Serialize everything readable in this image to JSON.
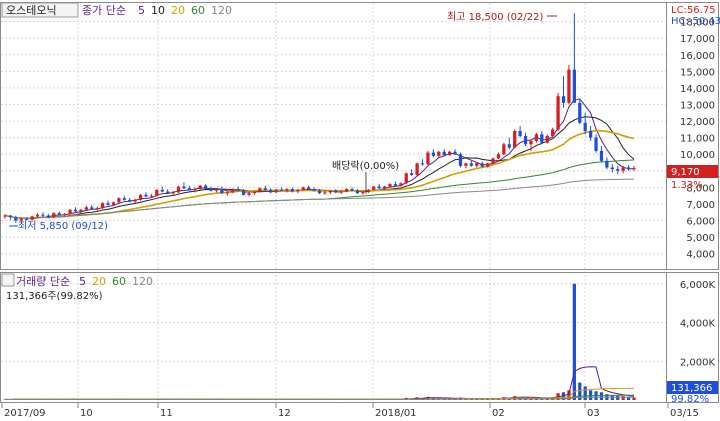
{
  "price_panel": {
    "stock_name": "오스테오닉",
    "ma_label": "종가 단순",
    "ma_periods": [
      "5",
      "10",
      "20",
      "60",
      "120"
    ],
    "ma_colors": [
      "#5a1e8c",
      "#222222",
      "#d4a000",
      "#2e8b2e",
      "#888888"
    ],
    "lc_text": "LC:56.75",
    "hc_text": "HC:-50.43",
    "high_annotation": "최고 18,500 (02/22)",
    "low_annotation": "최저 5,850 (09/12)",
    "dividend_annotation": "배당락(0.00%)",
    "current_price": "9,170",
    "current_change": "1.33%"
  },
  "volume_panel": {
    "label": "거래량 단순",
    "ma_periods": [
      "5",
      "20",
      "60",
      "120"
    ],
    "ma_colors": [
      "#5a1e8c",
      "#d4a000",
      "#2e8b2e",
      "#888888"
    ],
    "info_text": "131,366주(99.82%)",
    "current_volume": "131,366",
    "current_pct": "99.82%"
  },
  "x_axis": {
    "labels": [
      "2017/09",
      "10",
      "11",
      "12",
      "2018/01",
      "02",
      "03",
      "03/15"
    ]
  },
  "chart_data": {
    "type": "candlestick",
    "price_axis": {
      "ticks": [
        "4,000",
        "5,000",
        "6,000",
        "7,000",
        "8,000",
        "9,000",
        "10,000",
        "11,000",
        "12,000",
        "13,000",
        "14,000",
        "15,000",
        "16,000",
        "17,000",
        "18,000"
      ],
      "range": [
        3500,
        18700
      ]
    },
    "volume_axis": {
      "ticks": [
        "2,000K",
        "4,000K",
        "6,000K"
      ],
      "range": [
        0,
        6300
      ]
    },
    "up_color": "#d42020",
    "down_color": "#1f4fd8",
    "candles": [
      [
        6250,
        6400,
        6100,
        6300,
        30
      ],
      [
        6300,
        6350,
        6050,
        6200,
        25
      ],
      [
        6200,
        6300,
        5850,
        6000,
        60
      ],
      [
        6000,
        6200,
        5950,
        6100,
        35
      ],
      [
        6100,
        6200,
        6000,
        6050,
        25
      ],
      [
        6050,
        6300,
        6000,
        6250,
        40
      ],
      [
        6250,
        6450,
        6150,
        6350,
        35
      ],
      [
        6350,
        6500,
        6200,
        6300,
        30
      ],
      [
        6300,
        6400,
        6150,
        6200,
        25
      ],
      [
        6200,
        6500,
        6150,
        6450,
        45
      ],
      [
        6450,
        6550,
        6300,
        6350,
        30
      ],
      [
        6350,
        6450,
        6250,
        6400,
        25
      ],
      [
        6400,
        6700,
        6350,
        6650,
        55
      ],
      [
        6650,
        6800,
        6500,
        6550,
        40
      ],
      [
        6550,
        6700,
        6450,
        6650,
        30
      ],
      [
        6650,
        6900,
        6600,
        6800,
        45
      ],
      [
        6800,
        6950,
        6650,
        6700,
        35
      ],
      [
        6700,
        6850,
        6600,
        6750,
        30
      ],
      [
        6750,
        7100,
        6700,
        7050,
        60
      ],
      [
        7050,
        7200,
        6900,
        6950,
        40
      ],
      [
        6950,
        7150,
        6900,
        7100,
        35
      ],
      [
        7100,
        7400,
        7050,
        7350,
        55
      ],
      [
        7350,
        7500,
        7200,
        7250,
        40
      ],
      [
        7250,
        7350,
        7100,
        7150,
        30
      ],
      [
        7150,
        7300,
        7050,
        7250,
        30
      ],
      [
        7250,
        7600,
        7200,
        7550,
        60
      ],
      [
        7550,
        7700,
        7400,
        7450,
        45
      ],
      [
        7450,
        7600,
        7350,
        7500,
        30
      ],
      [
        7500,
        7900,
        7450,
        7850,
        70
      ],
      [
        7850,
        8050,
        7700,
        7750,
        55
      ],
      [
        7750,
        7900,
        7600,
        7650,
        35
      ],
      [
        7650,
        7800,
        7550,
        7700,
        30
      ],
      [
        7700,
        8100,
        7650,
        8050,
        75
      ],
      [
        8050,
        8300,
        7900,
        7950,
        60
      ],
      [
        7950,
        8100,
        7800,
        7850,
        40
      ],
      [
        7850,
        8000,
        7700,
        7900,
        35
      ],
      [
        7900,
        8150,
        7850,
        8100,
        50
      ],
      [
        8100,
        8200,
        7900,
        7950,
        40
      ],
      [
        7950,
        8050,
        7750,
        7800,
        35
      ],
      [
        7800,
        7950,
        7700,
        7900,
        30
      ],
      [
        7900,
        8050,
        7600,
        7650,
        40
      ],
      [
        7650,
        7800,
        7500,
        7700,
        35
      ],
      [
        7700,
        7950,
        7650,
        7900,
        45
      ],
      [
        7900,
        8050,
        7750,
        7800,
        35
      ],
      [
        7800,
        7900,
        7500,
        7550,
        40
      ],
      [
        7550,
        7700,
        7450,
        7650,
        30
      ],
      [
        7650,
        7800,
        7550,
        7750,
        30
      ],
      [
        7750,
        8000,
        7700,
        7950,
        45
      ],
      [
        7950,
        8100,
        7800,
        7850,
        40
      ],
      [
        7850,
        7950,
        7650,
        7700,
        30
      ],
      [
        7700,
        7900,
        7650,
        7850,
        35
      ],
      [
        7850,
        8000,
        7750,
        7800,
        30
      ],
      [
        7800,
        7950,
        7700,
        7900,
        30
      ],
      [
        7900,
        8000,
        7700,
        7750,
        30
      ],
      [
        7750,
        7900,
        7650,
        7850,
        35
      ],
      [
        7850,
        8050,
        7800,
        8000,
        40
      ],
      [
        8000,
        8100,
        7850,
        7900,
        30
      ],
      [
        7900,
        8000,
        7750,
        7800,
        30
      ],
      [
        7800,
        7900,
        7600,
        7650,
        35
      ],
      [
        7650,
        7800,
        7550,
        7700,
        30
      ],
      [
        7700,
        7850,
        7600,
        7800,
        30
      ],
      [
        7800,
        7900,
        7650,
        7700,
        30
      ],
      [
        7700,
        7850,
        7600,
        7750,
        25
      ],
      [
        7750,
        7950,
        7700,
        7900,
        35
      ],
      [
        7900,
        8000,
        7750,
        7800,
        30
      ],
      [
        7800,
        7900,
        7600,
        7650,
        35
      ],
      [
        7650,
        7800,
        7550,
        7750,
        30
      ],
      [
        7750,
        7900,
        7650,
        7850,
        30
      ],
      [
        7850,
        8100,
        7800,
        8050,
        50
      ],
      [
        8050,
        8200,
        7900,
        7950,
        40
      ],
      [
        7950,
        8100,
        7850,
        8050,
        35
      ],
      [
        8050,
        8250,
        8000,
        8200,
        45
      ],
      [
        8200,
        8350,
        8050,
        8100,
        40
      ],
      [
        8100,
        8300,
        8050,
        8250,
        45
      ],
      [
        8250,
        8900,
        8200,
        8850,
        110
      ],
      [
        8850,
        9100,
        8700,
        8750,
        80
      ],
      [
        8750,
        9500,
        8700,
        9450,
        140
      ],
      [
        9450,
        9700,
        9300,
        9400,
        100
      ],
      [
        9400,
        10200,
        9350,
        10100,
        160
      ],
      [
        10100,
        10300,
        9800,
        9900,
        110
      ],
      [
        9900,
        10200,
        9850,
        10150,
        90
      ],
      [
        10150,
        10300,
        9900,
        9950,
        80
      ],
      [
        9950,
        10200,
        9900,
        10150,
        70
      ],
      [
        10150,
        10300,
        9950,
        10000,
        70
      ],
      [
        10000,
        10100,
        9200,
        9300,
        120
      ],
      [
        9300,
        9500,
        9150,
        9450,
        80
      ],
      [
        9450,
        9600,
        9250,
        9300,
        60
      ],
      [
        9300,
        9500,
        9200,
        9450,
        55
      ],
      [
        9450,
        9550,
        9200,
        9250,
        50
      ],
      [
        9250,
        9500,
        9200,
        9450,
        60
      ],
      [
        9450,
        9800,
        9400,
        9750,
        80
      ],
      [
        9750,
        10100,
        9700,
        10000,
        100
      ],
      [
        10000,
        10700,
        9950,
        10600,
        150
      ],
      [
        10600,
        11000,
        10300,
        10400,
        120
      ],
      [
        10400,
        11500,
        10350,
        11400,
        200
      ],
      [
        11400,
        11700,
        11000,
        11100,
        150
      ],
      [
        11100,
        11300,
        10500,
        10600,
        120
      ],
      [
        10600,
        10900,
        10200,
        10800,
        100
      ],
      [
        10800,
        11300,
        10700,
        11200,
        110
      ],
      [
        11200,
        11400,
        10600,
        10700,
        100
      ],
      [
        10700,
        11200,
        10650,
        11100,
        110
      ],
      [
        11100,
        11600,
        11000,
        11500,
        140
      ],
      [
        11500,
        13700,
        11400,
        13500,
        350
      ],
      [
        13500,
        14700,
        12800,
        13100,
        400
      ],
      [
        13100,
        15400,
        13000,
        15100,
        500
      ],
      [
        15100,
        18500,
        14000,
        13100,
        6000
      ],
      [
        13100,
        13300,
        11800,
        11900,
        900
      ],
      [
        11900,
        12500,
        11200,
        11400,
        700
      ],
      [
        11400,
        11700,
        10800,
        11000,
        500
      ],
      [
        11000,
        11200,
        10100,
        10200,
        450
      ],
      [
        10200,
        10500,
        9500,
        9600,
        400
      ],
      [
        9600,
        9800,
        9100,
        9200,
        300
      ],
      [
        9200,
        9400,
        8900,
        9100,
        250
      ],
      [
        9100,
        9300,
        8800,
        9000,
        220
      ],
      [
        9000,
        9300,
        8850,
        9200,
        200
      ],
      [
        9200,
        9350,
        9000,
        9100,
        180
      ],
      [
        9100,
        9300,
        9000,
        9170,
        131
      ]
    ]
  }
}
